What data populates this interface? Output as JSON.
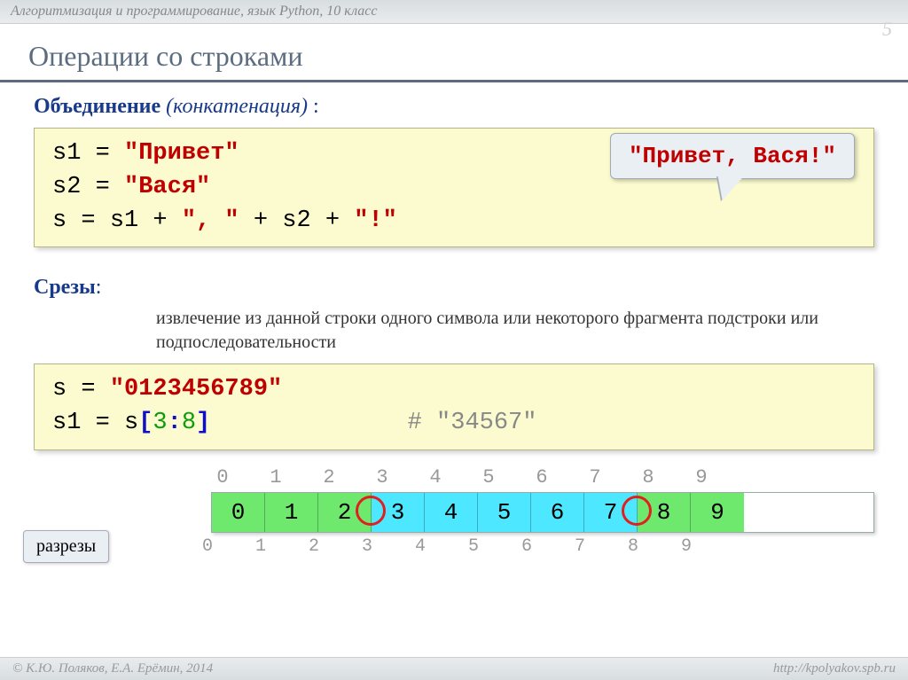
{
  "header": {
    "breadcrumb": "Алгоритмизация и программирование, язык Python, 10 класс"
  },
  "page_number": "5",
  "title": "Операции со строками",
  "section1": {
    "heading_bold": "Объединение",
    "heading_italic": "(конкатенация)",
    "heading_colon": " :",
    "code": {
      "l1": {
        "lhs": "s1",
        "eq": " = ",
        "val": "\"Привет\""
      },
      "l2": {
        "lhs": "s2",
        "eq": " = ",
        "val": "\"Вася\""
      },
      "l3": {
        "lhs": "s ",
        "eq": " = ",
        "a": "s1",
        "p1": " + ",
        "c1": "\", \"",
        "p2": " + ",
        "b": "s2",
        "p3": " + ",
        "c2": "\"!\""
      }
    },
    "callout": "\"Привет, Вася!\""
  },
  "section2": {
    "heading": "Срезы",
    "colon": ":",
    "desc": "извлечение из данной строки одного символа или некоторого фрагмента подстроки или подпоследовательности",
    "code": {
      "l1": {
        "lhs": "s",
        "eq": " = ",
        "val": "\"0123456789\""
      },
      "l2": {
        "lhs": "s1",
        "eq": " = ",
        "s": "s",
        "lb": "[",
        "a": "3",
        "colon": ":",
        "b": "8",
        "rb": "]",
        "comment": "# \"34567\""
      }
    }
  },
  "strip": {
    "top_index": [
      "0",
      "1",
      "2",
      "3",
      "4",
      "5",
      "6",
      "7",
      "8",
      "9"
    ],
    "cells": [
      "0",
      "1",
      "2",
      "3",
      "4",
      "5",
      "6",
      "7",
      "8",
      "9"
    ],
    "highlight_start": 3,
    "highlight_end": 7,
    "cuts_label": "разрезы",
    "bottom_index": [
      "0",
      "1",
      "2",
      "3",
      "4",
      "5",
      "6",
      "7",
      "8",
      "9"
    ]
  },
  "footer": {
    "left": "© К.Ю. Поляков, Е.А. Ерёмин, 2014",
    "right": "http://kpolyakov.spb.ru"
  }
}
